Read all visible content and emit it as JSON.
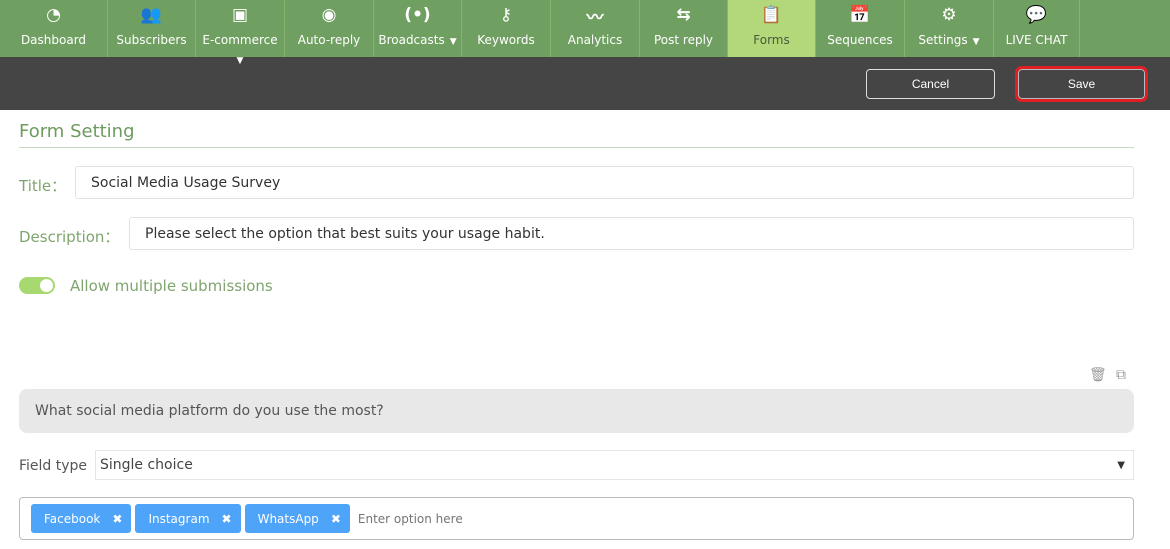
{
  "nav": {
    "items": [
      {
        "label": "Dashboard",
        "icon": "gauge-icon",
        "glyph": "◔",
        "w": 108
      },
      {
        "label": "Subscribers",
        "icon": "users-icon",
        "glyph": "👥",
        "w": 88
      },
      {
        "label": "E-commerce",
        "icon": "box-icon",
        "glyph": "▣",
        "w": 89,
        "submenu": true
      },
      {
        "label": "Auto-reply",
        "icon": "robot-icon",
        "glyph": "◉",
        "w": 89
      },
      {
        "label": "Broadcasts",
        "icon": "broadcast-icon",
        "glyph": "(•)",
        "w": 88,
        "dropdown": true
      },
      {
        "label": "Keywords",
        "icon": "key-icon",
        "glyph": "⚷",
        "w": 89
      },
      {
        "label": "Analytics",
        "icon": "chart-line-icon",
        "glyph": "〰",
        "w": 89
      },
      {
        "label": "Post reply",
        "icon": "reply-icon",
        "glyph": "⇆",
        "w": 88
      },
      {
        "label": "Forms",
        "icon": "form-icon",
        "glyph": "📋",
        "w": 88,
        "active": true
      },
      {
        "label": "Sequences",
        "icon": "calendar-check-icon",
        "glyph": "📅",
        "w": 89
      },
      {
        "label": "Settings",
        "icon": "gear-icon",
        "glyph": "⚙",
        "w": 89,
        "dropdown": true
      },
      {
        "label": "LIVE CHAT",
        "icon": "live-chat-icon",
        "glyph": "💬",
        "w": 86
      }
    ]
  },
  "toolbar": {
    "cancel": "Cancel",
    "save": "Save"
  },
  "form": {
    "section_title": "Form Setting",
    "title_label": "Title：",
    "title_value": "Social Media Usage Survey",
    "description_label": "Description：",
    "description_value": "Please select the option that best suits your usage habit.",
    "allow_multiple_label": "Allow multiple submissions",
    "allow_multiple": true
  },
  "question": {
    "text": "What social media platform do you use the most?",
    "field_type_label": "Field type",
    "field_type": "Single choice",
    "options": [
      "Facebook",
      "Instagram",
      "WhatsApp"
    ],
    "option_placeholder": "Enter option here"
  },
  "colors": {
    "nav": "#709f62",
    "active": "#b2d87a",
    "tag": "#4ea4f9",
    "highlight": "#e01e26"
  }
}
